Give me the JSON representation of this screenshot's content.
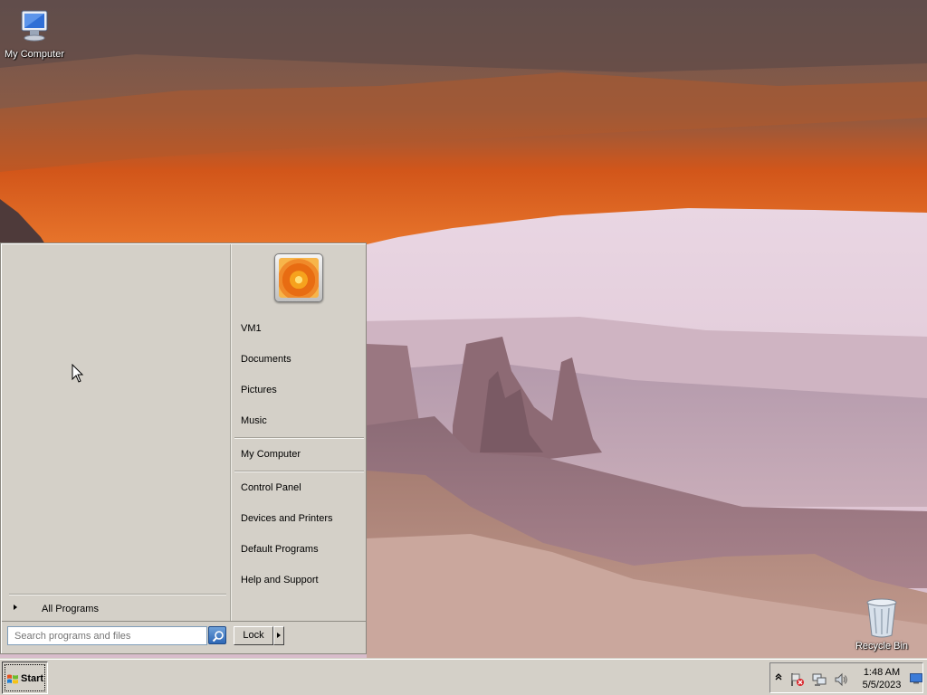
{
  "desktop": {
    "icons": [
      {
        "label": "My Computer",
        "icon": "my-computer-icon"
      },
      {
        "label": "Recycle Bin",
        "icon": "recycle-bin-icon"
      }
    ]
  },
  "start_menu": {
    "right_items": [
      {
        "label": "VM1"
      },
      {
        "label": "Documents"
      },
      {
        "label": "Pictures"
      },
      {
        "label": "Music"
      },
      {
        "label": "My Computer"
      },
      {
        "label": "Control Panel"
      },
      {
        "label": "Devices and Printers"
      },
      {
        "label": "Default Programs"
      },
      {
        "label": "Help and Support"
      }
    ],
    "all_programs_label": "All Programs",
    "search_placeholder": "Search programs and files",
    "lock_label": "Lock"
  },
  "taskbar": {
    "start_label": "Start",
    "clock_time": "1:48 AM",
    "clock_date": "5/5/2023",
    "tray_icons": [
      "action-center-flag-icon",
      "network-icon",
      "volume-icon"
    ]
  },
  "colors": {
    "chrome": "#d4d0c8",
    "search_border": "#7f9db9",
    "accent_blue": "#2d67b6"
  }
}
